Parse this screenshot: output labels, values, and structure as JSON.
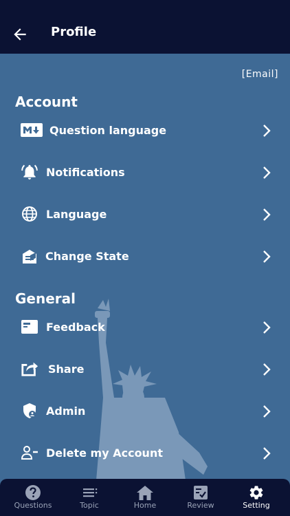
{
  "header": {
    "title": "Profile"
  },
  "account_email": "[Email]",
  "sections": {
    "account_title": "Account",
    "general_title": "General"
  },
  "rows": {
    "question_language": "Question language",
    "notifications": "Notifications",
    "language": "Language",
    "change_state": "Change State",
    "feedback": "Feedback",
    "share": "Share",
    "admin": "Admin",
    "delete_account": "Delete my Account"
  },
  "bottom_nav": {
    "questions": "Questions",
    "topic": "Topic",
    "home": "Home",
    "review": "Review",
    "setting": "Setting",
    "active": "setting"
  },
  "colors": {
    "header_bg": "#0b1233",
    "content_bg": "#3f6a95",
    "nav_inactive": "#9aa3b7",
    "nav_active": "#ffffff"
  }
}
